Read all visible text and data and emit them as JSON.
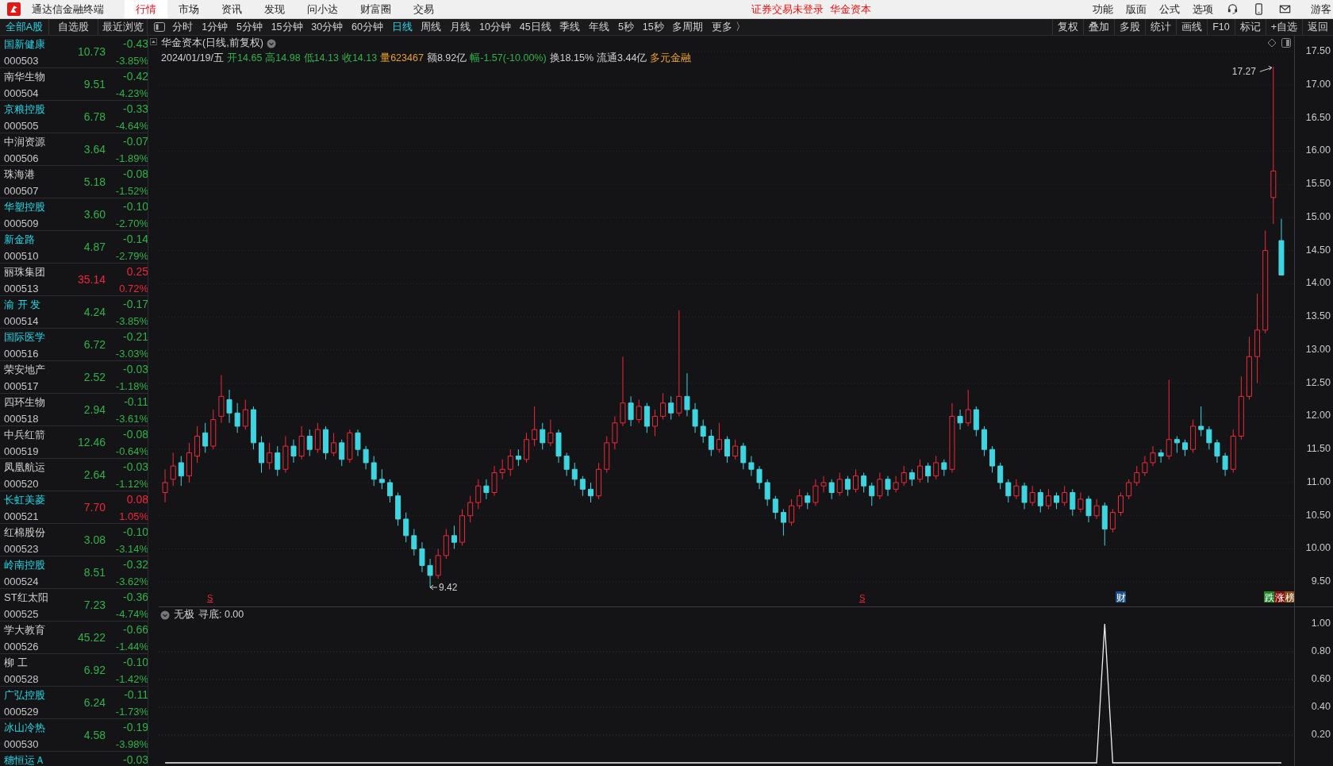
{
  "app": {
    "title": "通达信金融终端"
  },
  "menu": [
    {
      "label": "行情",
      "selected": true
    },
    {
      "label": "市场",
      "selected": false
    },
    {
      "label": "资讯",
      "selected": false
    },
    {
      "label": "发现",
      "selected": false
    },
    {
      "label": "问小达",
      "selected": false
    },
    {
      "label": "财富圈",
      "selected": false
    },
    {
      "label": "交易",
      "selected": false
    }
  ],
  "notice": {
    "status": "证券交易未登录",
    "account": "华金资本"
  },
  "right_menu": [
    "功能",
    "版面",
    "公式",
    "选项"
  ],
  "user": "游客",
  "list_tabs": [
    {
      "label": "全部A股",
      "selected": true
    },
    {
      "label": "自选股",
      "selected": false
    },
    {
      "label": "最近浏览",
      "selected": false
    }
  ],
  "period_tabs": [
    {
      "label": "分时",
      "selected": false
    },
    {
      "label": "1分钟",
      "selected": false
    },
    {
      "label": "5分钟",
      "selected": false
    },
    {
      "label": "15分钟",
      "selected": false
    },
    {
      "label": "30分钟",
      "selected": false
    },
    {
      "label": "60分钟",
      "selected": false
    },
    {
      "label": "日线",
      "selected": true
    },
    {
      "label": "周线",
      "selected": false
    },
    {
      "label": "月线",
      "selected": false
    },
    {
      "label": "10分钟",
      "selected": false
    },
    {
      "label": "45日线",
      "selected": false
    },
    {
      "label": "季线",
      "selected": false
    },
    {
      "label": "年线",
      "selected": false
    },
    {
      "label": "5秒",
      "selected": false
    },
    {
      "label": "15秒",
      "selected": false
    },
    {
      "label": "多周期",
      "selected": false
    },
    {
      "label": "更多 〉",
      "selected": false
    }
  ],
  "tool_buttons": [
    "复权",
    "叠加",
    "多股",
    "统计",
    "画线",
    "F10",
    "标记",
    "+自选",
    "返回"
  ],
  "stocks": [
    {
      "name": "国新健康",
      "code": "000503",
      "price": "10.73",
      "change": "-0.43",
      "percent": "-3.85%",
      "color": "#2fb24a",
      "highlighted": true
    },
    {
      "name": "南华生物",
      "code": "000504",
      "price": "9.51",
      "change": "-0.42",
      "percent": "-4.23%",
      "color": "#2fb24a",
      "highlighted": false
    },
    {
      "name": "京粮控股",
      "code": "000505",
      "price": "6.78",
      "change": "-0.33",
      "percent": "-4.64%",
      "color": "#2fb24a",
      "highlighted": true
    },
    {
      "name": "中润资源",
      "code": "000506",
      "price": "3.64",
      "change": "-0.07",
      "percent": "-1.89%",
      "color": "#2fb24a",
      "highlighted": false
    },
    {
      "name": "珠海港",
      "code": "000507",
      "price": "5.18",
      "change": "-0.08",
      "percent": "-1.52%",
      "color": "#2fb24a",
      "highlighted": false
    },
    {
      "name": "华塑控股",
      "code": "000509",
      "price": "3.60",
      "change": "-0.10",
      "percent": "-2.70%",
      "color": "#2fb24a",
      "highlighted": true
    },
    {
      "name": "新金路",
      "code": "000510",
      "price": "4.87",
      "change": "-0.14",
      "percent": "-2.79%",
      "color": "#2fb24a",
      "highlighted": true
    },
    {
      "name": "丽珠集团",
      "code": "000513",
      "price": "35.14",
      "change": "0.25",
      "percent": "0.72%",
      "color": "#f2253c",
      "highlighted": false
    },
    {
      "name": "渝 开 发",
      "code": "000514",
      "price": "4.24",
      "change": "-0.17",
      "percent": "-3.85%",
      "color": "#2fb24a",
      "highlighted": true
    },
    {
      "name": "国际医学",
      "code": "000516",
      "price": "6.72",
      "change": "-0.21",
      "percent": "-3.03%",
      "color": "#2fb24a",
      "highlighted": true
    },
    {
      "name": "荣安地产",
      "code": "000517",
      "price": "2.52",
      "change": "-0.03",
      "percent": "-1.18%",
      "color": "#2fb24a",
      "highlighted": false
    },
    {
      "name": "四环生物",
      "code": "000518",
      "price": "2.94",
      "change": "-0.11",
      "percent": "-3.61%",
      "color": "#2fb24a",
      "highlighted": false
    },
    {
      "name": "中兵红箭",
      "code": "000519",
      "price": "12.46",
      "change": "-0.08",
      "percent": "-0.64%",
      "color": "#2fb24a",
      "highlighted": false
    },
    {
      "name": "凤凰航运",
      "code": "000520",
      "price": "2.64",
      "change": "-0.03",
      "percent": "-1.12%",
      "color": "#2fb24a",
      "highlighted": false
    },
    {
      "name": "长虹美菱",
      "code": "000521",
      "price": "7.70",
      "change": "0.08",
      "percent": "1.05%",
      "color": "#f2253c",
      "highlighted": true
    },
    {
      "name": "红棉股份",
      "code": "000523",
      "price": "3.08",
      "change": "-0.10",
      "percent": "-3.14%",
      "color": "#2fb24a",
      "highlighted": false
    },
    {
      "name": "岭南控股",
      "code": "000524",
      "price": "8.51",
      "change": "-0.32",
      "percent": "-3.62%",
      "color": "#2fb24a",
      "highlighted": true
    },
    {
      "name": "ST红太阳",
      "code": "000525",
      "price": "7.23",
      "change": "-0.36",
      "percent": "-4.74%",
      "color": "#2fb24a",
      "highlighted": false
    },
    {
      "name": "学大教育",
      "code": "000526",
      "price": "45.22",
      "change": "-0.66",
      "percent": "-1.44%",
      "color": "#2fb24a",
      "highlighted": false
    },
    {
      "name": "柳 工",
      "code": "000528",
      "price": "6.92",
      "change": "-0.10",
      "percent": "-1.42%",
      "color": "#2fb24a",
      "highlighted": false
    },
    {
      "name": "广弘控股",
      "code": "000529",
      "price": "6.24",
      "change": "-0.11",
      "percent": "-1.73%",
      "color": "#2fb24a",
      "highlighted": true
    },
    {
      "name": "冰山冷热",
      "code": "000530",
      "price": "4.58",
      "change": "-0.19",
      "percent": "-3.98%",
      "color": "#2fb24a",
      "highlighted": true
    },
    {
      "name": "穗恒运Ａ",
      "change": "-0.03",
      "color": "#2fb24a",
      "highlighted": true
    }
  ],
  "chart": {
    "title": "华金资本(日线,前复权)",
    "info": [
      {
        "text": "2024/01/19/五",
        "color": "#d0d0d0"
      },
      {
        "text": "开14.65",
        "color": "#2fb24a"
      },
      {
        "text": "高14.98",
        "color": "#2fb24a"
      },
      {
        "text": "低14.13",
        "color": "#2fb24a"
      },
      {
        "text": "收14.13",
        "color": "#2fb24a"
      },
      {
        "text": "量623467",
        "color": "#e8a02c"
      },
      {
        "text": "额8.92亿",
        "color": "#d0d0d0"
      },
      {
        "text": "幅-1.57(-10.00%)",
        "color": "#2fb24a"
      },
      {
        "text": "换18.15%",
        "color": "#d0d0d0"
      },
      {
        "text": "流通3.44亿",
        "color": "#d0d0d0"
      },
      {
        "text": "多元金融",
        "color": "#e8a02c"
      }
    ],
    "chart_data": {
      "type": "candlestick",
      "grid": true,
      "ohlc": [
        [
          10.85,
          11.2,
          10.7,
          11.0
        ],
        [
          11.05,
          11.45,
          10.95,
          11.25
        ],
        [
          11.3,
          11.4,
          10.95,
          11.1
        ],
        [
          11.1,
          11.6,
          11.0,
          11.45
        ],
        [
          11.4,
          11.85,
          11.3,
          11.7
        ],
        [
          11.75,
          11.9,
          11.45,
          11.55
        ],
        [
          11.55,
          12.1,
          11.5,
          11.95
        ],
        [
          12.0,
          12.62,
          11.9,
          12.3
        ],
        [
          12.25,
          12.4,
          11.9,
          12.05
        ],
        [
          12.05,
          12.2,
          11.75,
          11.85
        ],
        [
          11.85,
          12.25,
          11.8,
          12.1
        ],
        [
          12.1,
          12.15,
          11.5,
          11.6
        ],
        [
          11.6,
          11.7,
          11.15,
          11.3
        ],
        [
          11.3,
          11.6,
          11.2,
          11.45
        ],
        [
          11.45,
          11.55,
          11.1,
          11.2
        ],
        [
          11.2,
          11.7,
          11.15,
          11.55
        ],
        [
          11.55,
          11.65,
          11.3,
          11.4
        ],
        [
          11.4,
          11.85,
          11.35,
          11.7
        ],
        [
          11.7,
          11.8,
          11.4,
          11.5
        ],
        [
          11.5,
          11.9,
          11.45,
          11.8
        ],
        [
          11.8,
          11.85,
          11.35,
          11.45
        ],
        [
          11.45,
          11.75,
          11.4,
          11.6
        ],
        [
          11.6,
          11.65,
          11.25,
          11.35
        ],
        [
          11.35,
          11.8,
          11.3,
          11.75
        ],
        [
          11.75,
          11.8,
          11.4,
          11.5
        ],
        [
          11.5,
          11.55,
          11.2,
          11.3
        ],
        [
          11.3,
          11.4,
          10.95,
          11.05
        ],
        [
          11.05,
          11.2,
          10.9,
          11.0
        ],
        [
          11.0,
          11.05,
          10.7,
          10.8
        ],
        [
          10.8,
          10.85,
          10.35,
          10.45
        ],
        [
          10.45,
          10.55,
          10.1,
          10.2
        ],
        [
          10.2,
          10.3,
          9.9,
          10.0
        ],
        [
          10.0,
          10.1,
          9.65,
          9.75
        ],
        [
          9.75,
          9.85,
          9.42,
          9.6
        ],
        [
          9.6,
          10.0,
          9.55,
          9.9
        ],
        [
          9.9,
          10.3,
          9.85,
          10.2
        ],
        [
          10.2,
          10.35,
          10.0,
          10.1
        ],
        [
          10.1,
          10.6,
          10.05,
          10.5
        ],
        [
          10.5,
          10.8,
          10.4,
          10.7
        ],
        [
          10.7,
          11.05,
          10.6,
          10.95
        ],
        [
          10.95,
          11.05,
          10.75,
          10.85
        ],
        [
          10.85,
          11.25,
          10.8,
          11.15
        ],
        [
          11.15,
          11.35,
          11.05,
          11.2
        ],
        [
          11.2,
          11.5,
          11.1,
          11.4
        ],
        [
          11.4,
          11.5,
          11.25,
          11.35
        ],
        [
          11.35,
          11.75,
          11.3,
          11.65
        ],
        [
          11.65,
          12.15,
          11.55,
          11.8
        ],
        [
          11.8,
          11.9,
          11.5,
          11.6
        ],
        [
          11.6,
          11.95,
          11.55,
          11.75
        ],
        [
          11.75,
          11.8,
          11.3,
          11.4
        ],
        [
          11.4,
          11.45,
          11.1,
          11.2
        ],
        [
          11.2,
          11.3,
          10.95,
          11.05
        ],
        [
          11.05,
          11.1,
          10.8,
          10.9
        ],
        [
          10.9,
          11.0,
          10.7,
          10.8
        ],
        [
          10.8,
          11.3,
          10.75,
          11.2
        ],
        [
          11.2,
          11.7,
          11.15,
          11.6
        ],
        [
          11.6,
          12.0,
          11.5,
          11.9
        ],
        [
          11.9,
          12.9,
          11.85,
          12.2
        ],
        [
          12.2,
          12.3,
          11.85,
          11.95
        ],
        [
          11.95,
          12.25,
          11.9,
          12.15
        ],
        [
          12.15,
          12.2,
          11.75,
          11.85
        ],
        [
          11.85,
          12.1,
          11.7,
          12.0
        ],
        [
          12.0,
          12.35,
          11.95,
          12.2
        ],
        [
          12.2,
          12.3,
          11.95,
          12.05
        ],
        [
          12.05,
          13.6,
          12.0,
          12.3
        ],
        [
          12.3,
          12.65,
          12.0,
          12.1
        ],
        [
          12.1,
          12.2,
          11.75,
          11.85
        ],
        [
          11.85,
          11.95,
          11.6,
          11.7
        ],
        [
          11.7,
          11.8,
          11.4,
          11.5
        ],
        [
          11.5,
          11.9,
          11.45,
          11.65
        ],
        [
          11.65,
          11.7,
          11.3,
          11.4
        ],
        [
          11.4,
          11.65,
          11.35,
          11.55
        ],
        [
          11.55,
          11.6,
          11.2,
          11.3
        ],
        [
          11.3,
          11.4,
          11.1,
          11.2
        ],
        [
          11.2,
          11.25,
          10.9,
          11.0
        ],
        [
          11.0,
          11.05,
          10.65,
          10.75
        ],
        [
          10.75,
          10.8,
          10.45,
          10.55
        ],
        [
          10.55,
          10.6,
          10.2,
          10.4
        ],
        [
          10.4,
          10.75,
          10.35,
          10.65
        ],
        [
          10.65,
          10.9,
          10.6,
          10.8
        ],
        [
          10.8,
          10.85,
          10.6,
          10.7
        ],
        [
          10.7,
          11.05,
          10.65,
          10.95
        ],
        [
          10.95,
          11.1,
          10.85,
          11.0
        ],
        [
          11.0,
          11.05,
          10.75,
          10.85
        ],
        [
          10.85,
          11.15,
          10.8,
          11.05
        ],
        [
          11.05,
          11.1,
          10.8,
          10.9
        ],
        [
          10.9,
          11.2,
          10.85,
          11.1
        ],
        [
          11.1,
          11.15,
          10.85,
          10.95
        ],
        [
          10.95,
          11.0,
          10.65,
          10.8
        ],
        [
          10.8,
          11.15,
          10.75,
          11.05
        ],
        [
          11.05,
          11.1,
          10.8,
          10.9
        ],
        [
          10.9,
          11.1,
          10.85,
          11.0
        ],
        [
          11.0,
          11.25,
          10.95,
          11.15
        ],
        [
          11.15,
          11.2,
          10.95,
          11.05
        ],
        [
          11.05,
          11.35,
          11.0,
          11.25
        ],
        [
          11.25,
          11.3,
          11.0,
          11.1
        ],
        [
          11.1,
          11.4,
          11.05,
          11.3
        ],
        [
          11.3,
          11.35,
          11.1,
          11.2
        ],
        [
          11.2,
          12.2,
          11.15,
          12.0
        ],
        [
          12.0,
          12.1,
          11.8,
          11.9
        ],
        [
          11.9,
          12.4,
          11.85,
          12.1
        ],
        [
          12.1,
          12.15,
          11.7,
          11.8
        ],
        [
          11.8,
          11.85,
          11.4,
          11.5
        ],
        [
          11.5,
          11.55,
          11.15,
          11.25
        ],
        [
          11.25,
          11.3,
          10.9,
          11.0
        ],
        [
          11.0,
          11.05,
          10.7,
          10.8
        ],
        [
          10.8,
          11.05,
          10.75,
          10.95
        ],
        [
          10.95,
          11.0,
          10.6,
          10.7
        ],
        [
          10.7,
          10.95,
          10.65,
          10.85
        ],
        [
          10.85,
          10.9,
          10.55,
          10.65
        ],
        [
          10.65,
          10.9,
          10.6,
          10.8
        ],
        [
          10.8,
          10.85,
          10.6,
          10.7
        ],
        [
          10.7,
          10.95,
          10.65,
          10.85
        ],
        [
          10.85,
          10.9,
          10.5,
          10.6
        ],
        [
          10.6,
          10.85,
          10.55,
          10.75
        ],
        [
          10.75,
          10.8,
          10.4,
          10.5
        ],
        [
          10.5,
          10.75,
          10.45,
          10.65
        ],
        [
          10.65,
          10.7,
          10.05,
          10.3
        ],
        [
          10.3,
          10.6,
          10.25,
          10.55
        ],
        [
          10.55,
          10.85,
          10.5,
          10.8
        ],
        [
          10.8,
          11.05,
          10.75,
          11.0
        ],
        [
          11.0,
          11.25,
          10.95,
          11.15
        ],
        [
          11.15,
          11.4,
          11.1,
          11.3
        ],
        [
          11.3,
          11.55,
          11.25,
          11.45
        ],
        [
          11.45,
          11.5,
          11.3,
          11.4
        ],
        [
          11.4,
          12.55,
          11.35,
          11.65
        ],
        [
          11.65,
          11.7,
          11.45,
          11.6
        ],
        [
          11.6,
          11.65,
          11.4,
          11.5
        ],
        [
          11.5,
          11.95,
          11.45,
          11.85
        ],
        [
          11.85,
          12.15,
          11.7,
          11.8
        ],
        [
          11.8,
          11.85,
          11.5,
          11.6
        ],
        [
          11.6,
          11.65,
          11.3,
          11.4
        ],
        [
          11.4,
          11.45,
          11.1,
          11.2
        ],
        [
          11.2,
          11.8,
          11.15,
          11.7
        ],
        [
          11.7,
          12.6,
          11.65,
          12.3
        ],
        [
          12.3,
          13.2,
          12.25,
          12.9
        ],
        [
          12.9,
          13.85,
          12.5,
          13.3
        ],
        [
          13.3,
          14.8,
          13.25,
          14.5
        ],
        [
          15.3,
          17.27,
          14.9,
          15.7
        ],
        [
          14.65,
          14.98,
          14.13,
          14.13
        ]
      ],
      "ylim": [
        9.12,
        17.74
      ],
      "yticks": [
        {
          "value": 17.5,
          "label": "17.50"
        },
        {
          "value": 17,
          "label": "17.00"
        },
        {
          "value": 16.5,
          "label": "16.50"
        },
        {
          "value": 16,
          "label": "16.00"
        },
        {
          "value": 15.5,
          "label": "15.50"
        },
        {
          "value": 15,
          "label": "15.00"
        },
        {
          "value": 14.5,
          "label": "14.50"
        },
        {
          "value": 14,
          "label": "14.00"
        },
        {
          "value": 13.5,
          "label": "13.50"
        },
        {
          "value": 13,
          "label": "13.00"
        },
        {
          "value": 12.5,
          "label": "12.50"
        },
        {
          "value": 12,
          "label": "12.00"
        },
        {
          "value": 11.5,
          "label": "11.50"
        },
        {
          "value": 11,
          "label": "11.00"
        },
        {
          "value": 10.5,
          "label": "10.50"
        },
        {
          "value": 10,
          "label": "10.00"
        },
        {
          "value": 9.5,
          "label": "9.50"
        }
      ],
      "annotations": [
        "17.27",
        "9.42"
      ]
    },
    "markers": [
      {
        "text": "S",
        "kind": "signal"
      },
      {
        "text": "S",
        "kind": "signal"
      },
      {
        "text": "财",
        "kind": "badge",
        "color": "#1c4f8a"
      },
      {
        "text": "跌",
        "kind": "badge",
        "color": "#1f8a2a"
      },
      {
        "text": "涨",
        "kind": "badge",
        "color": "#8a1010"
      },
      {
        "text": "榜",
        "kind": "badge",
        "color": "#8a5018"
      }
    ]
  },
  "indicator": {
    "name": "无极",
    "reading": "寻底: 0.00",
    "chart_data": {
      "type": "line",
      "grid": true,
      "values": [
        0,
        0,
        0,
        0,
        0,
        0,
        0,
        0,
        0,
        0,
        0,
        0,
        0,
        0,
        0,
        0,
        0,
        0,
        0,
        0,
        0,
        0,
        0,
        0,
        0,
        0,
        0,
        0,
        0,
        0,
        0,
        0,
        0,
        0,
        0,
        0,
        0,
        0,
        0,
        0,
        0,
        0,
        0,
        0,
        0,
        0,
        0,
        0,
        0,
        0,
        0,
        0,
        0,
        0,
        0,
        0,
        0,
        0,
        0,
        0,
        0,
        0,
        0,
        0,
        0,
        0,
        0,
        0,
        0,
        0,
        0,
        0,
        0,
        0,
        0,
        0,
        0,
        0,
        0,
        0,
        0,
        0,
        0,
        0,
        0,
        0,
        0,
        0,
        0,
        0,
        0,
        0,
        0,
        0,
        0,
        0,
        0,
        0,
        0,
        0,
        0,
        0,
        0,
        0,
        0,
        0,
        0,
        0,
        0,
        0,
        0,
        0,
        0,
        0,
        0,
        0,
        0,
        1,
        0,
        0,
        0,
        0,
        0,
        0,
        0,
        0,
        0,
        0,
        0,
        0,
        0,
        0,
        0,
        0,
        0,
        0,
        0,
        0,
        0,
        0
      ],
      "ylim": [
        -0.023,
        1.12
      ],
      "yticks": [
        {
          "value": 1,
          "label": "1.00"
        },
        {
          "value": 0.8,
          "label": "0.80"
        },
        {
          "value": 0.6,
          "label": "0.60"
        },
        {
          "value": 0.4,
          "label": "0.40"
        },
        {
          "value": 0.2,
          "label": "0.20"
        }
      ]
    }
  }
}
